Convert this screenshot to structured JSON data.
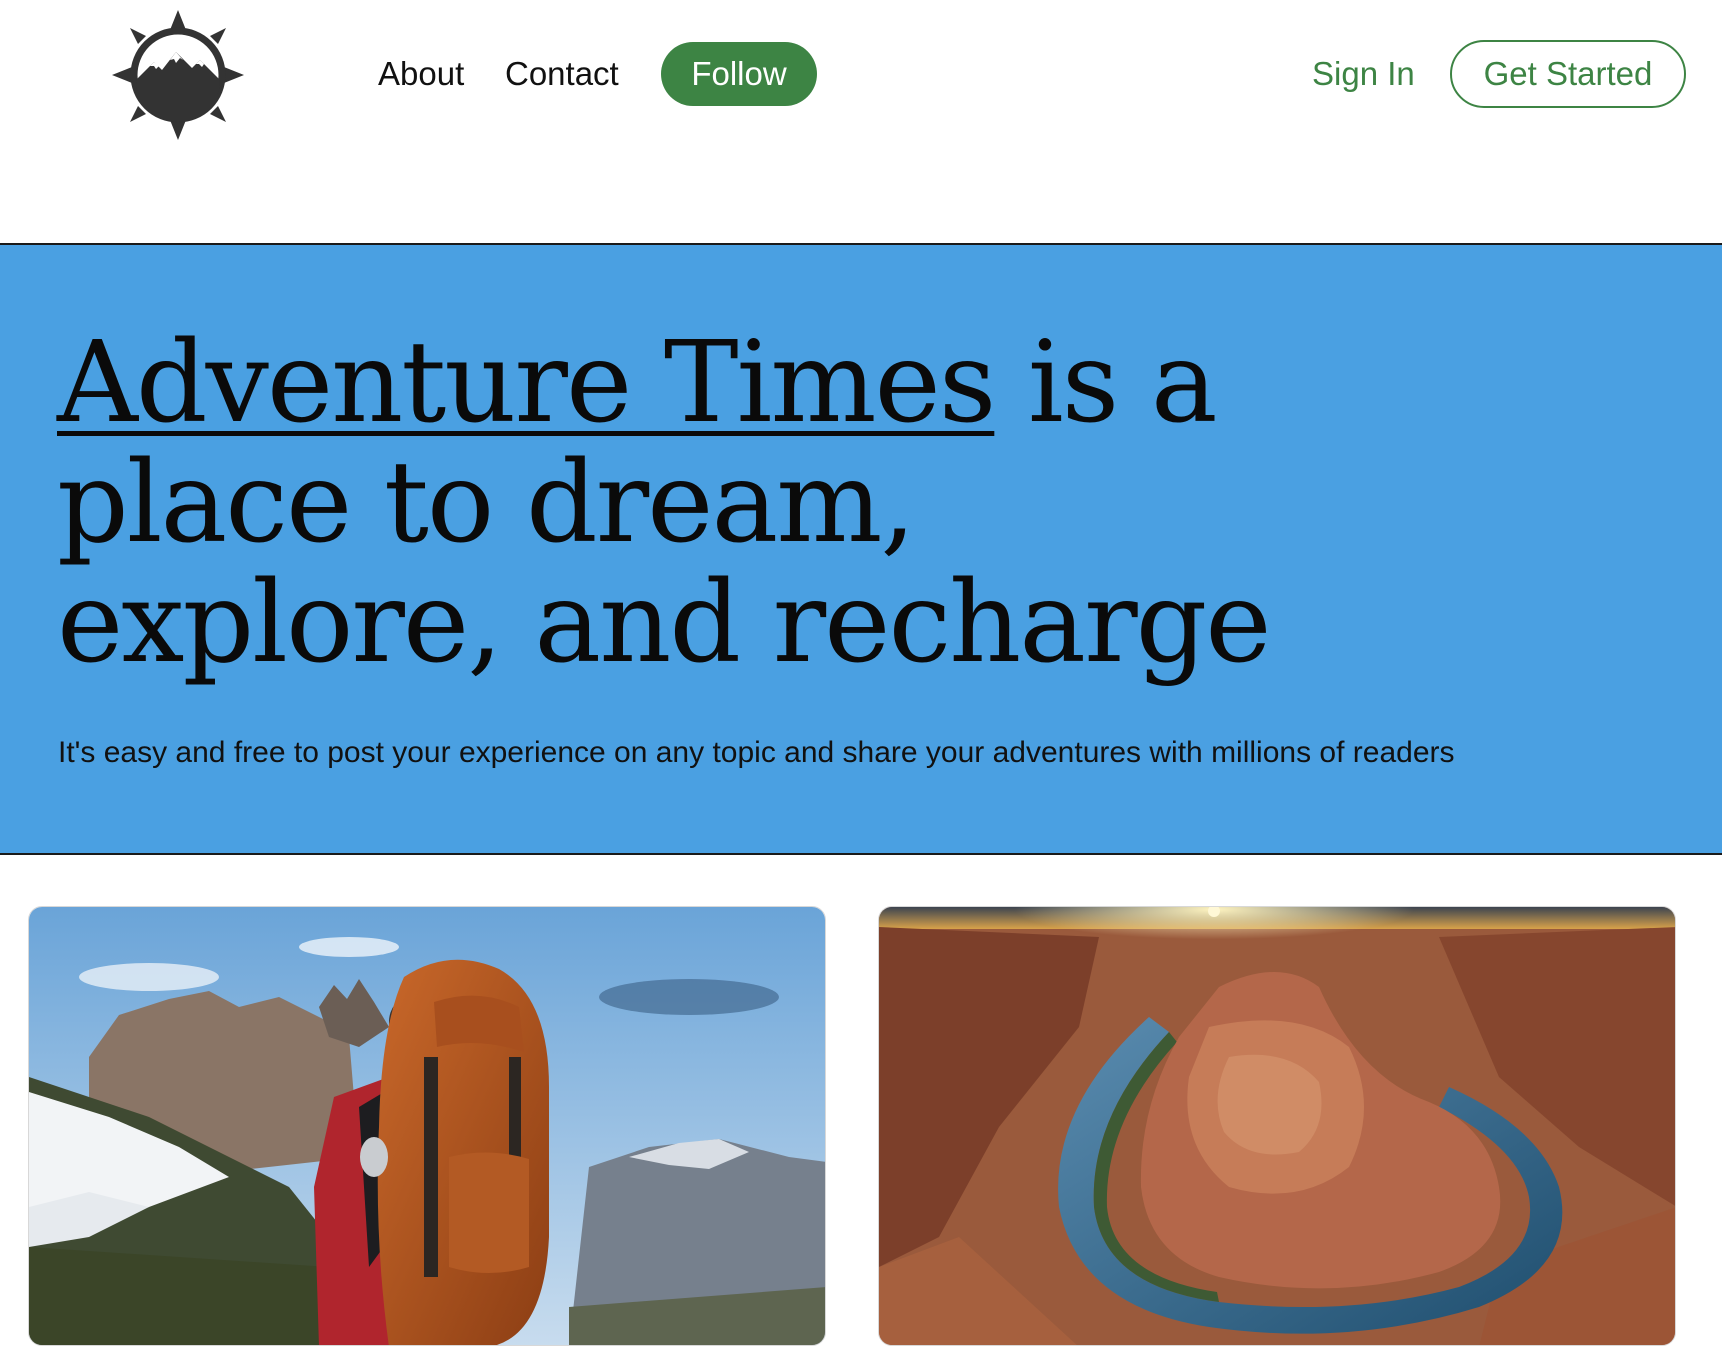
{
  "header": {
    "logo_icon": "compass-mountain-logo",
    "nav": {
      "about_label": "About",
      "contact_label": "Contact",
      "follow_label": "Follow"
    },
    "signin_label": "Sign In",
    "get_started_label": "Get Started"
  },
  "hero": {
    "title_brand": "Adventure Times",
    "title_rest": " is a place to dream, explore, and recharge",
    "subtitle": "It's easy and free to post your experience on any topic and share your adventures with millions of readers"
  },
  "cards": [
    {
      "image_name": "hiker-with-orange-backpack-image"
    },
    {
      "image_name": "horseshoe-bend-canyon-image"
    }
  ],
  "colors": {
    "brand_green": "#3d8444",
    "hero_blue": "#4aa0e2",
    "text_dark": "#111111"
  }
}
